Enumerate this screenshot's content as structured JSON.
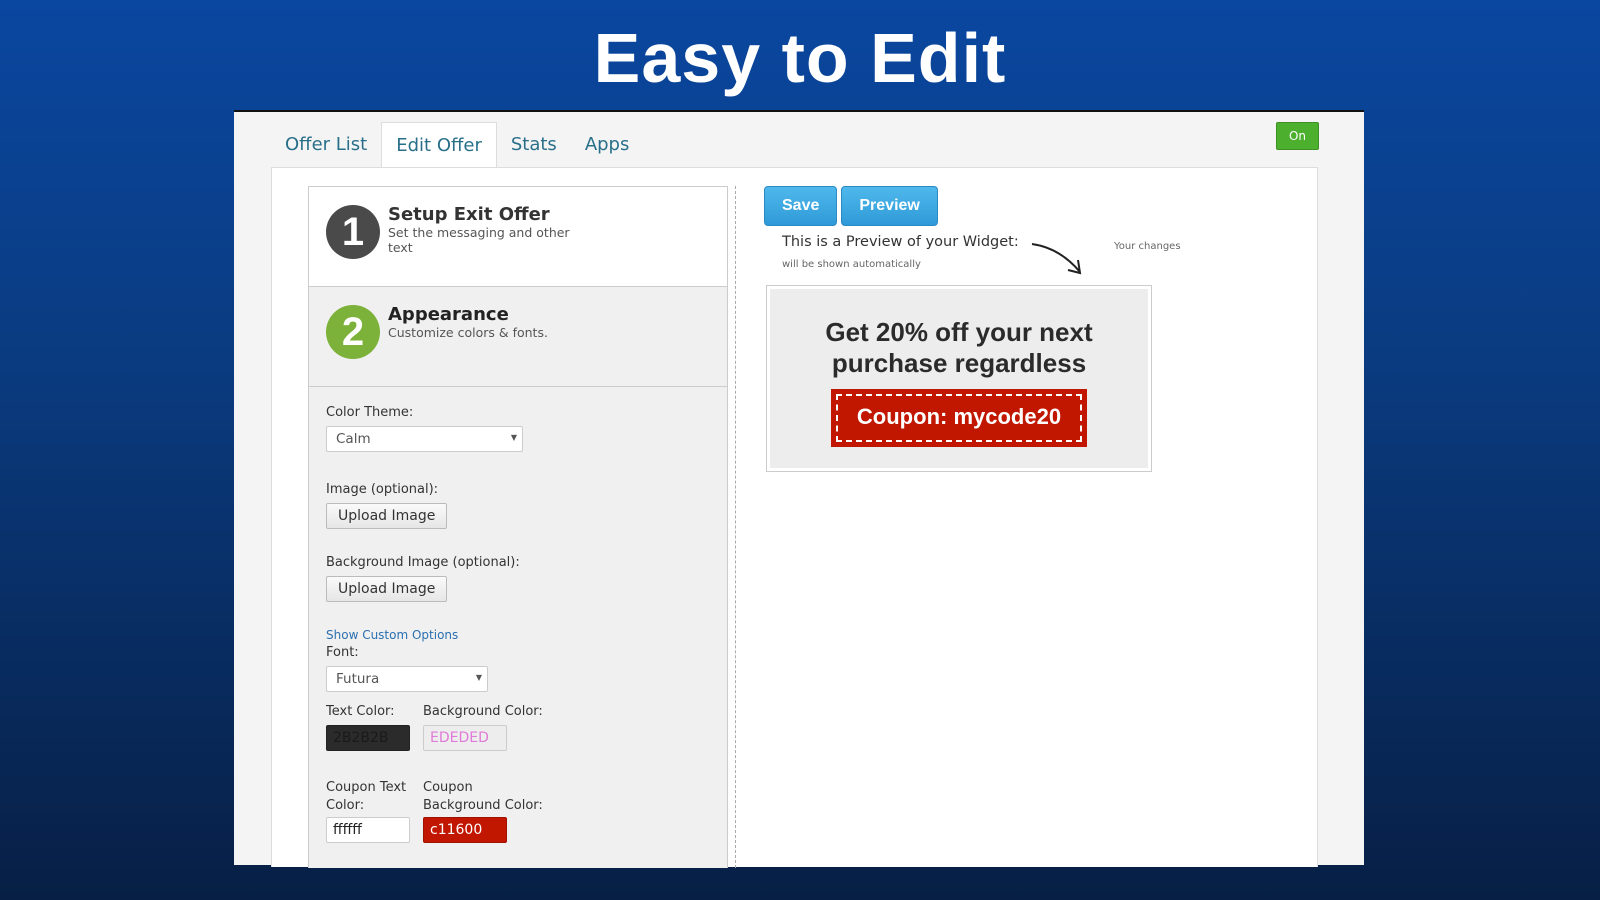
{
  "heading": "Easy to Edit",
  "tabs": [
    "Offer List",
    "Edit Offer",
    "Stats",
    "Apps"
  ],
  "toggle": "On",
  "steps": [
    {
      "num": "1",
      "title": "Setup Exit Offer",
      "desc": "Set the messaging and other text"
    },
    {
      "num": "2",
      "title": "Appearance",
      "desc": "Customize colors & fonts."
    }
  ],
  "form": {
    "color_theme_label": "Color Theme:",
    "color_theme": "Calm",
    "image_label": "Image (optional):",
    "upload": "Upload Image",
    "bg_image_label": "Background Image (optional):",
    "custom_link": "Show Custom Options",
    "font_label": "Font:",
    "font": "Futura",
    "text_color_label": "Text Color:",
    "text_color": "2B2B2B",
    "bg_color_label": "Background Color:",
    "bg_color": "EDEDED",
    "coupon_text_label": "Coupon Text Color:",
    "coupon_text_color": "ffffff",
    "coupon_bg_label": "Coupon Background Color:",
    "coupon_bg_color": "c11600"
  },
  "actions": {
    "save": "Save",
    "preview": "Preview"
  },
  "preview": {
    "label": "This is a Preview of your Widget:",
    "sub": "will be shown automatically",
    "note": "Your changes",
    "headline": "Get 20% off your next purchase regardless",
    "coupon": "Coupon: mycode20"
  }
}
